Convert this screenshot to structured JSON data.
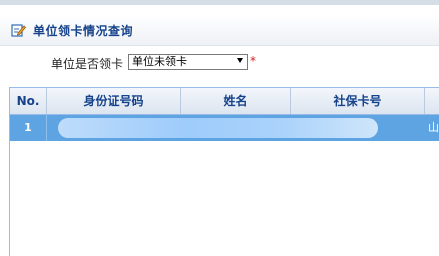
{
  "panel": {
    "title": "单位领卡情况查询",
    "icon": "edit-icon"
  },
  "filter": {
    "label": "单位是否领卡",
    "selected": "单位未领卡",
    "required_mark": "*"
  },
  "grid": {
    "columns": [
      "No.",
      "身份证号码",
      "姓名",
      "社保卡号"
    ],
    "rows": [
      {
        "no": "1",
        "trailing": "山"
      }
    ]
  },
  "colors": {
    "header_text": "#15428b",
    "row_selected": "#5ea3e2",
    "grid_border": "#99bbe8"
  }
}
